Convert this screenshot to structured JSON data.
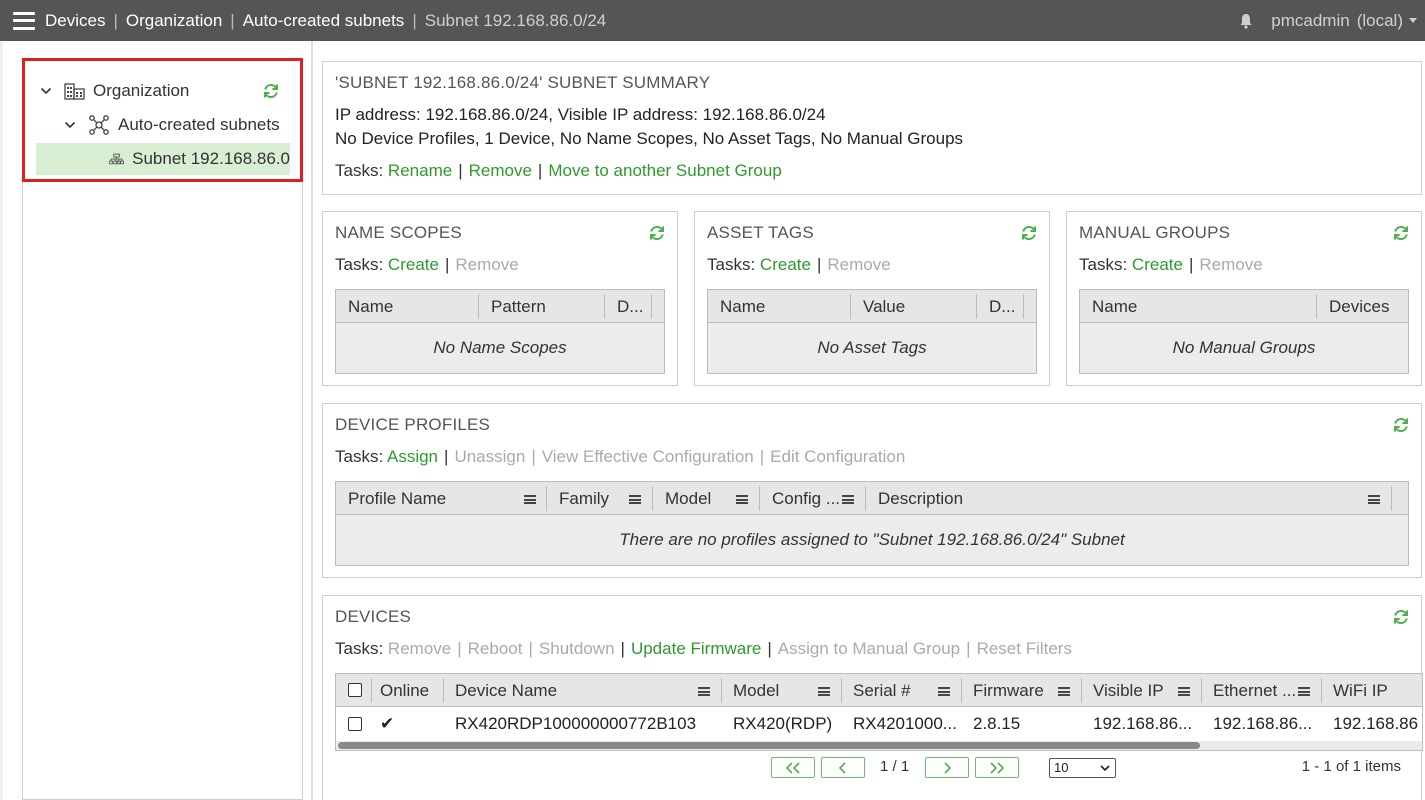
{
  "header": {
    "breadcrumbs": [
      "Devices",
      "Organization",
      "Auto-created subnets",
      "Subnet 192.168.86.0/24"
    ],
    "separator": "|",
    "user": "pmcadmin",
    "user_realm": "(local)"
  },
  "tree": {
    "items": [
      {
        "label": "Organization",
        "icon": "building-icon",
        "expanded": true
      },
      {
        "label": "Auto-created subnets",
        "icon": "network-nodes-icon",
        "expanded": true
      },
      {
        "label": "Subnet 192.168.86.0",
        "icon": "subnet-icon",
        "selected": true
      }
    ]
  },
  "summary": {
    "title": "'SUBNET 192.168.86.0/24' SUBNET SUMMARY",
    "line1": "IP address: 192.168.86.0/24, Visible IP address: 192.168.86.0/24",
    "line2": "No Device Profiles, 1 Device, No Name Scopes, No Asset Tags, No Manual Groups",
    "tasks_label": "Tasks:",
    "tasks": [
      "Rename",
      "Remove",
      "Move to another Subnet Group"
    ]
  },
  "name_scopes": {
    "title": "NAME SCOPES",
    "tasks_label": "Tasks:",
    "task_create": "Create",
    "task_remove": "Remove",
    "columns": [
      "Name",
      "Pattern",
      "D..."
    ],
    "empty": "No Name Scopes"
  },
  "asset_tags": {
    "title": "ASSET TAGS",
    "tasks_label": "Tasks:",
    "task_create": "Create",
    "task_remove": "Remove",
    "columns": [
      "Name",
      "Value",
      "D..."
    ],
    "empty": "No Asset Tags"
  },
  "manual_groups": {
    "title": "MANUAL GROUPS",
    "tasks_label": "Tasks:",
    "task_create": "Create",
    "task_remove": "Remove",
    "columns": [
      "Name",
      "Devices"
    ],
    "empty": "No Manual Groups"
  },
  "device_profiles": {
    "title": "DEVICE PROFILES",
    "tasks_label": "Tasks:",
    "task_assign": "Assign",
    "task_unassign": "Unassign",
    "task_view": "View Effective Configuration",
    "task_edit": "Edit Configuration",
    "columns": [
      "Profile Name",
      "Family",
      "Model",
      "Config ...",
      "Description"
    ],
    "empty": "There are no profiles assigned to \"Subnet 192.168.86.0/24\" Subnet"
  },
  "devices": {
    "title": "DEVICES",
    "tasks_label": "Tasks:",
    "task_remove": "Remove",
    "task_reboot": "Reboot",
    "task_shutdown": "Shutdown",
    "task_update": "Update Firmware",
    "task_assign_group": "Assign to Manual Group",
    "task_reset": "Reset Filters",
    "columns": [
      "Online",
      "Device Name",
      "Model",
      "Serial #",
      "Firmware",
      "Visible IP",
      "Ethernet ...",
      "WiFi IP"
    ],
    "rows": [
      {
        "online": "✔",
        "device_name": "RX420RDP100000000772B103",
        "model": "RX420(RDP)",
        "serial": "RX4201000...",
        "firmware": "2.8.15",
        "visible_ip": "192.168.86...",
        "ethernet": "192.168.86...",
        "wifi_ip": "192.168.86"
      }
    ],
    "pager": {
      "page": "1 / 1",
      "page_size": "10",
      "items": "1 - 1 of 1 items"
    }
  },
  "colors": {
    "topbar": "#555555",
    "link_green": "#2e9a2e",
    "selected_row": "#d9efd4",
    "highlight_red": "#e02020"
  }
}
